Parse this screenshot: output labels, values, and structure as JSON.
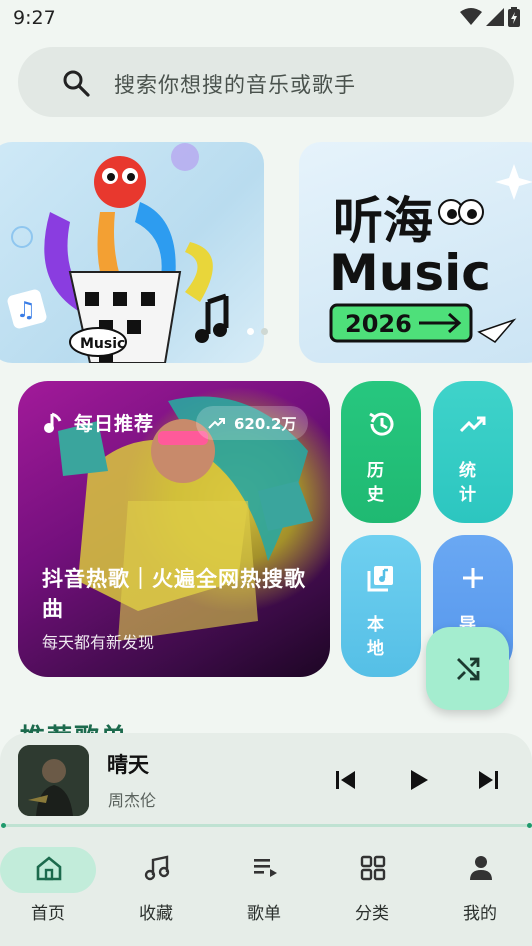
{
  "status_bar": {
    "time": "9:27"
  },
  "search": {
    "placeholder": "搜索你想搜的音乐或歌手"
  },
  "banners": [
    {
      "name": "banner-music",
      "text": "Music"
    },
    {
      "name": "banner-tinghai",
      "line1": "听海",
      "line2": "Music",
      "year": "2026"
    }
  ],
  "daily": {
    "label": "每日推荐",
    "plays": "620.2万",
    "title": "抖音热歌｜火遍全网热搜歌曲",
    "subtitle": "每天都有新发现"
  },
  "tiles": {
    "history": "历史",
    "stats": "统计",
    "local": "本地",
    "import": "导"
  },
  "section_peek": "推荐歌单",
  "player": {
    "title": "晴天",
    "artist": "周杰伦",
    "progress": 0
  },
  "nav": [
    {
      "label": "首页",
      "active": true
    },
    {
      "label": "收藏"
    },
    {
      "label": "歌单"
    },
    {
      "label": "分类"
    },
    {
      "label": "我的"
    }
  ],
  "colors": {
    "accent": "#1f9a6c",
    "nav_active_pill": "#c2ecda",
    "history_tile": "#27c77f",
    "stats_tile": "#3fd3ca",
    "local_tile": "#6fd0f0",
    "import_tile": "#6aa8f3",
    "fab": "#a4edcf"
  }
}
